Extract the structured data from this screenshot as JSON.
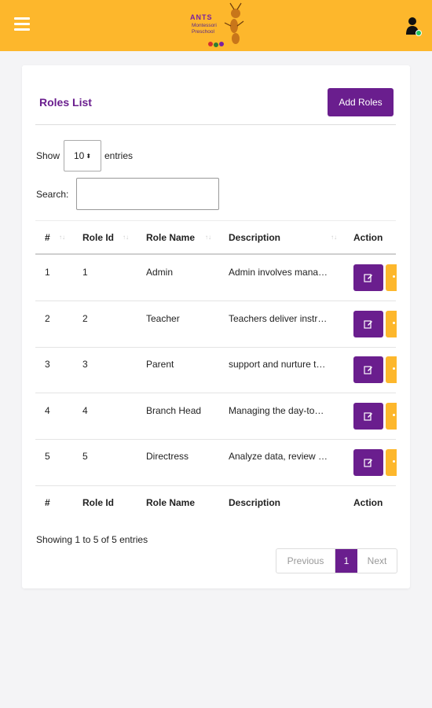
{
  "header": {
    "logo_title": "ANTS",
    "logo_line1": "Montessori",
    "logo_line2": "Preschool"
  },
  "card": {
    "title": "Roles List",
    "add_button": "Add Roles"
  },
  "controls": {
    "show_label": "Show",
    "length_value": "10",
    "entries_label": "entries",
    "search_label": "Search:",
    "search_value": ""
  },
  "table": {
    "columns": [
      "#",
      "Role Id",
      "Role Name",
      "Description",
      "Action"
    ],
    "rows": [
      {
        "num": "1",
        "role_id": "1",
        "role_name": "Admin",
        "description": "Admin involves mana…"
      },
      {
        "num": "2",
        "role_id": "2",
        "role_name": "Teacher",
        "description": "Teachers deliver instr…"
      },
      {
        "num": "3",
        "role_id": "3",
        "role_name": "Parent",
        "description": "support and nurture t…"
      },
      {
        "num": "4",
        "role_id": "4",
        "role_name": "Branch Head",
        "description": "Managing the day-to…"
      },
      {
        "num": "5",
        "role_id": "5",
        "role_name": "Directress",
        "description": "Analyze data, review …"
      }
    ]
  },
  "footer": {
    "info": "Showing 1 to 5 of 5 entries",
    "previous": "Previous",
    "page": "1",
    "next": "Next"
  },
  "colors": {
    "accent": "#6a1e8e",
    "header": "#fdb72c"
  }
}
